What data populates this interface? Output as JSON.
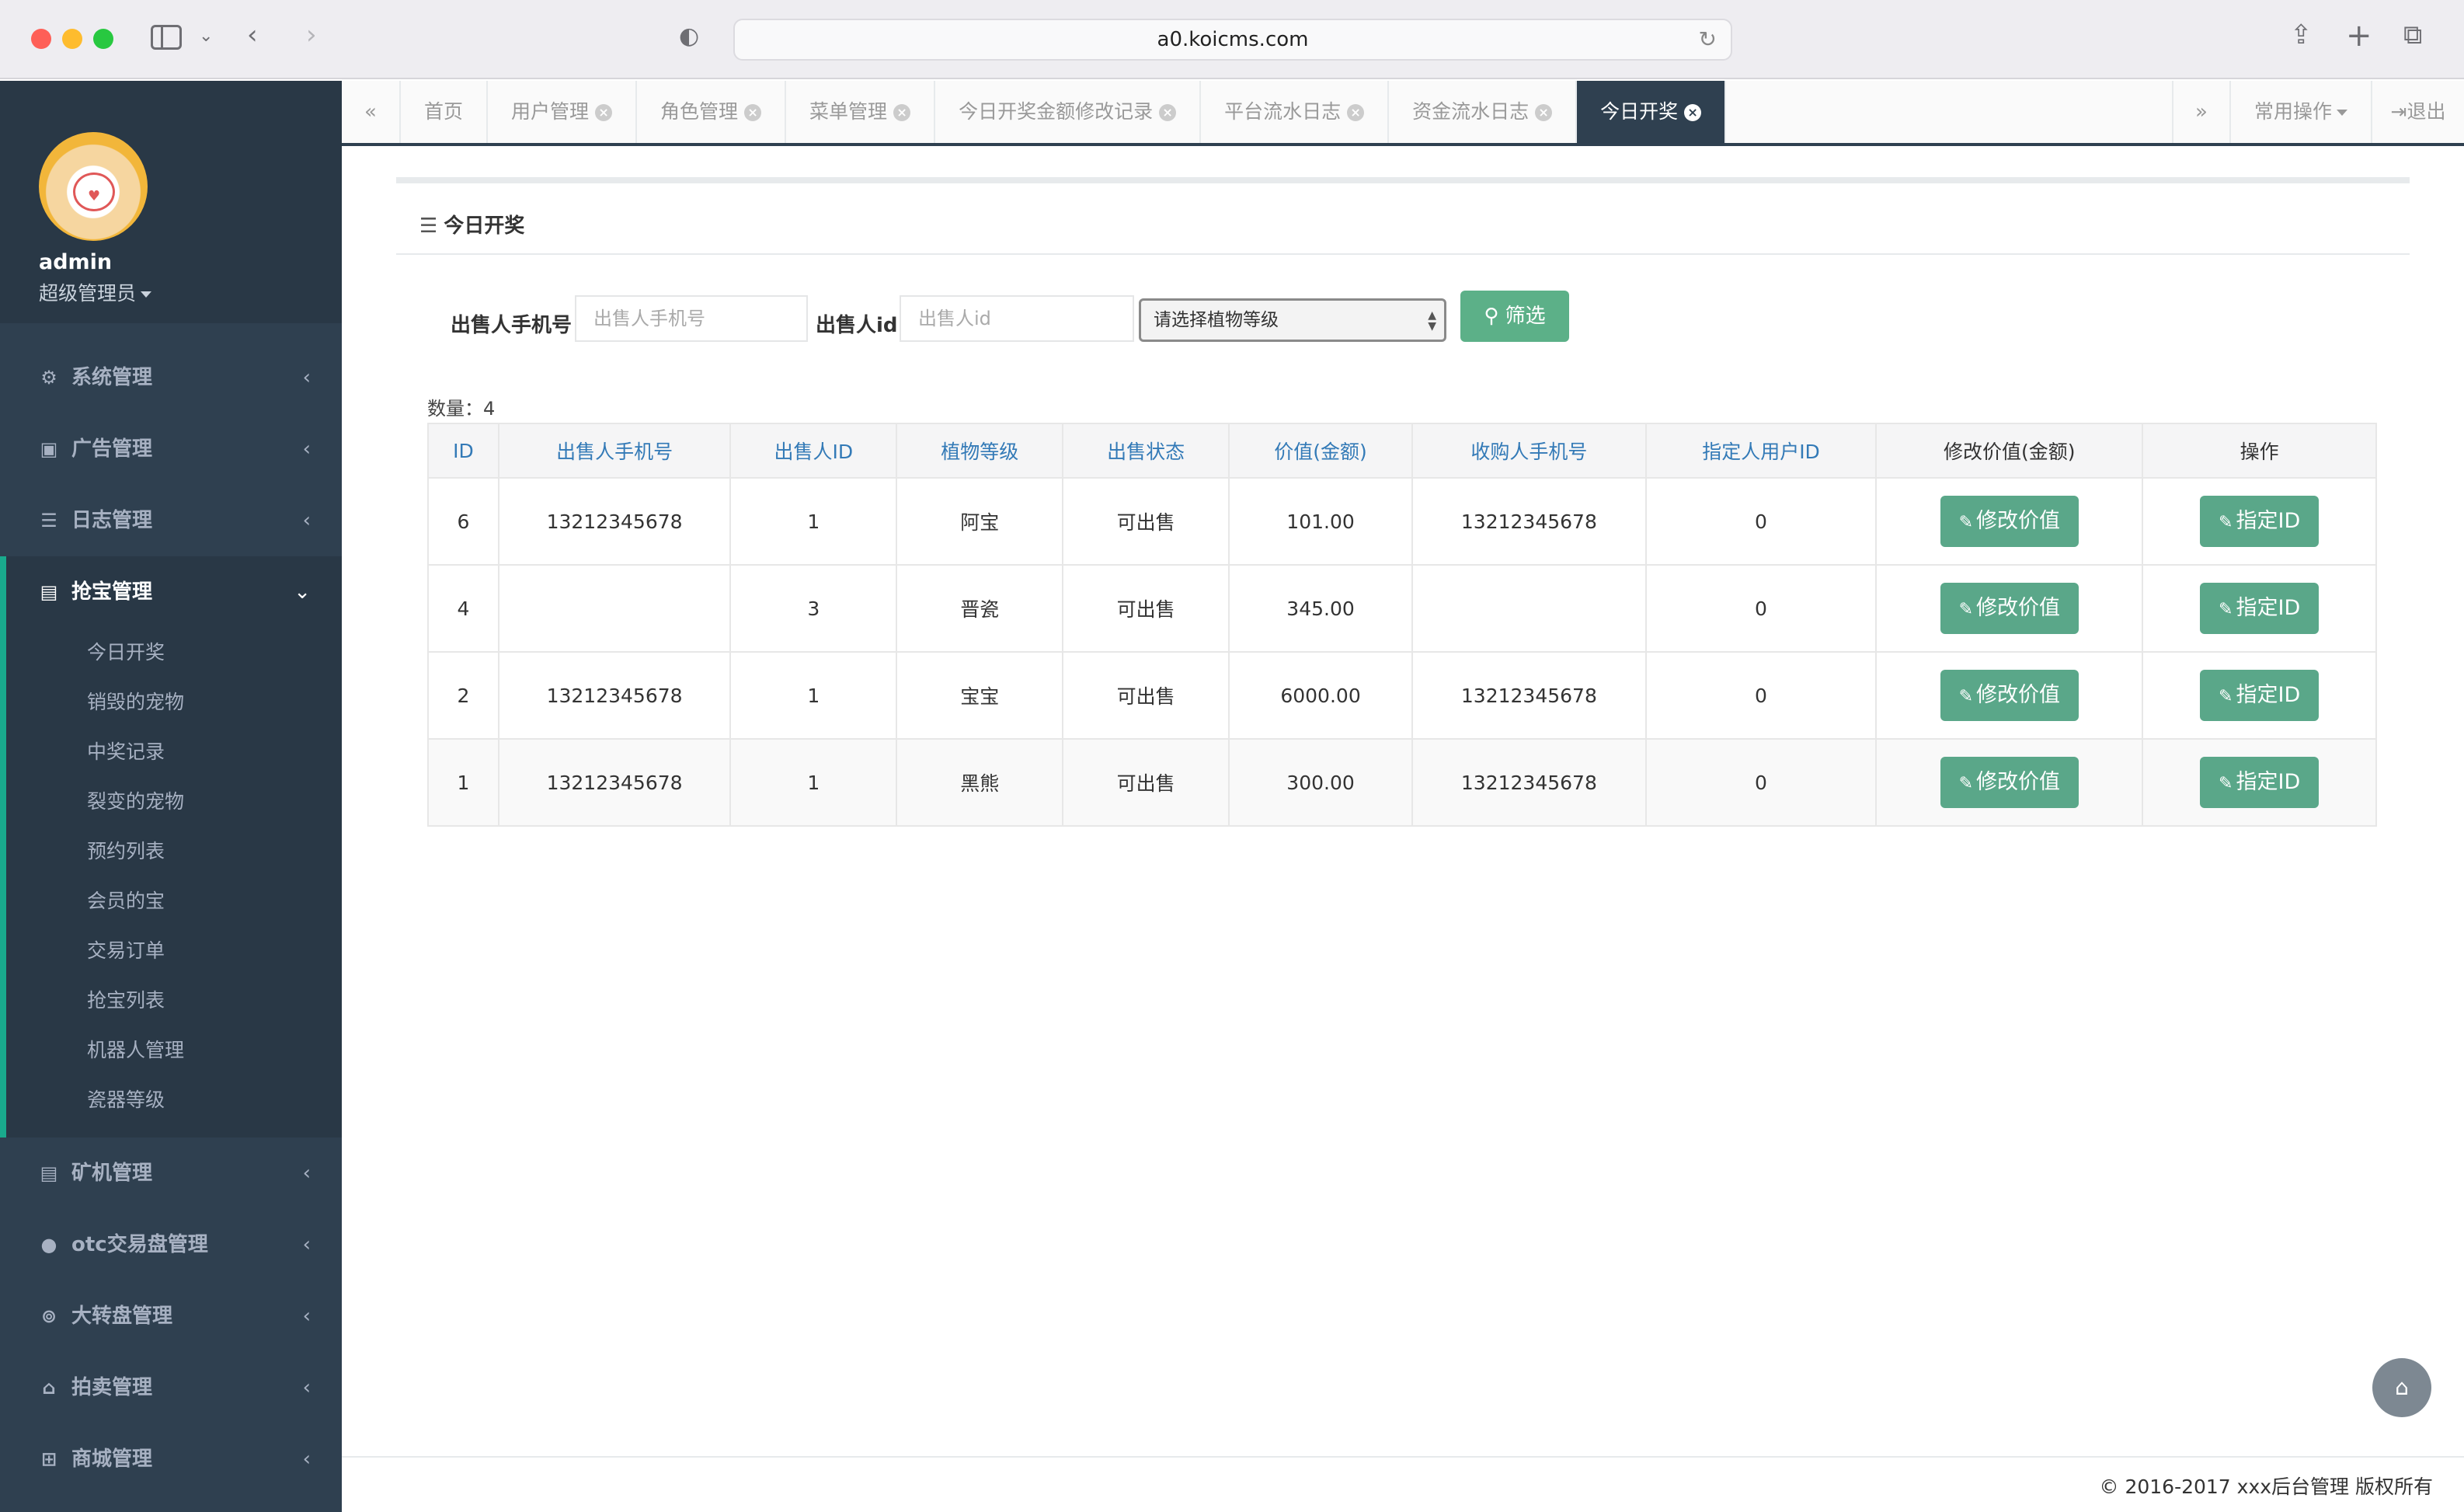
{
  "browser": {
    "url": "a0.koicms.com"
  },
  "profile": {
    "name": "admin",
    "role": "超级管理员"
  },
  "nav": {
    "items_top": [
      {
        "label": "系统管理",
        "icon": "gear-icon"
      },
      {
        "label": "广告管理",
        "icon": "image-icon"
      },
      {
        "label": "日志管理",
        "icon": "list-icon"
      }
    ],
    "active_group": {
      "label": "抢宝管理",
      "icon": "book-icon",
      "sub_items": [
        "今日开奖",
        "销毁的宠物",
        "中奖记录",
        "裂变的宠物",
        "预约列表",
        "会员的宝",
        "交易订单",
        "抢宝列表",
        "机器人管理",
        "瓷器等级"
      ]
    },
    "items_bottom": [
      {
        "label": "矿机管理",
        "icon": "book-icon"
      },
      {
        "label": "otc交易盘管理",
        "icon": "user-icon"
      },
      {
        "label": "大转盘管理",
        "icon": "gamepad-icon"
      },
      {
        "label": "拍卖管理",
        "icon": "bank-icon"
      },
      {
        "label": "商城管理",
        "icon": "cart-icon"
      }
    ]
  },
  "tabbar": {
    "tabs": [
      "首页",
      "用户管理",
      "角色管理",
      "菜单管理",
      "今日开奖金额修改记录",
      "平台流水日志",
      "资金流水日志",
      "今日开奖"
    ],
    "active_tab": "今日开奖",
    "common_ops": "常用操作",
    "logout": "退出"
  },
  "panel": {
    "title": "今日开奖"
  },
  "filter": {
    "phone_label": "出售人手机号",
    "phone_placeholder": "出售人手机号",
    "id_label": "出售人id",
    "id_placeholder": "出售人id",
    "grade_select": "请选择植物等级",
    "button": "筛选"
  },
  "count_label": "数量：4",
  "table": {
    "headers": [
      "ID",
      "出售人手机号",
      "出售人ID",
      "植物等级",
      "出售状态",
      "价值(金额)",
      "收购人手机号",
      "指定人用户ID",
      "修改价值(金额)",
      "操作"
    ],
    "rows": [
      {
        "id": "6",
        "seller_phone": "13212345678",
        "seller_id": "1",
        "grade": "阿宝",
        "status": "可出售",
        "value": "101.00",
        "buyer_phone": "13212345678",
        "assignee_id": "0"
      },
      {
        "id": "4",
        "seller_phone": "",
        "seller_id": "3",
        "grade": "晋瓷",
        "status": "可出售",
        "value": "345.00",
        "buyer_phone": "",
        "assignee_id": "0"
      },
      {
        "id": "2",
        "seller_phone": "13212345678",
        "seller_id": "1",
        "grade": "宝宝",
        "status": "可出售",
        "value": "6000.00",
        "buyer_phone": "13212345678",
        "assignee_id": "0"
      },
      {
        "id": "1",
        "seller_phone": "13212345678",
        "seller_id": "1",
        "grade": "黑熊",
        "status": "可出售",
        "value": "300.00",
        "buyer_phone": "13212345678",
        "assignee_id": "0"
      }
    ],
    "edit_button": "修改价值",
    "assign_button": "指定ID"
  },
  "footer": {
    "copyright": "© 2016-2017 xxx后台管理 版权所有"
  },
  "colors": {
    "sidebar_bg": "#2f4050",
    "accent_green": "#5aa789",
    "link_blue": "#337ab7"
  }
}
